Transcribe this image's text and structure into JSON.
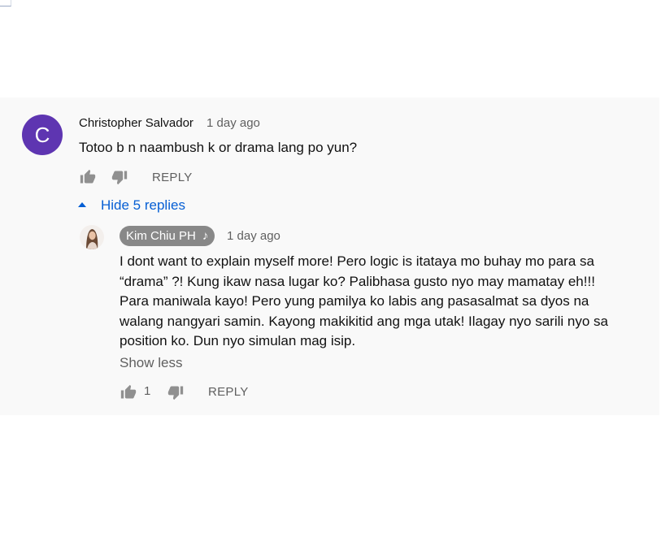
{
  "comment": {
    "avatar_letter": "C",
    "avatar_color": "#5e35b1",
    "author": "Christopher Salvador",
    "time": "1 day ago",
    "text": "Totoo b n naambush k or drama lang po yun?",
    "like_icon": "thumbs-up-icon",
    "dislike_icon": "thumbs-down-icon",
    "reply_label": "REPLY"
  },
  "replies_toggle": {
    "label": "Hide 5 replies",
    "icon": "caret-up-icon",
    "color": "#065fd4"
  },
  "reply": {
    "author": "Kim Chiu PH",
    "badge_icon": "music-note-icon",
    "badge_note": "♪",
    "time": "1 day ago",
    "lines": [
      "I dont want to explain myself more! Pero logic is itataya mo buhay mo para sa",
      "“drama” ?! Kung ikaw nasa lugar ko? Palibhasa gusto nyo may mamatay eh!!!",
      "Para maniwala kayo! Pero yung pamilya ko labis ang pasasalmat sa dyos na",
      "walang nangyari samin. Kayong makikitid ang mga utak! Ilagay nyo sarili nyo sa",
      "position ko. Dun nyo simulan mag isip."
    ],
    "show_less_label": "Show less",
    "like_count": "1",
    "reply_label": "REPLY"
  }
}
